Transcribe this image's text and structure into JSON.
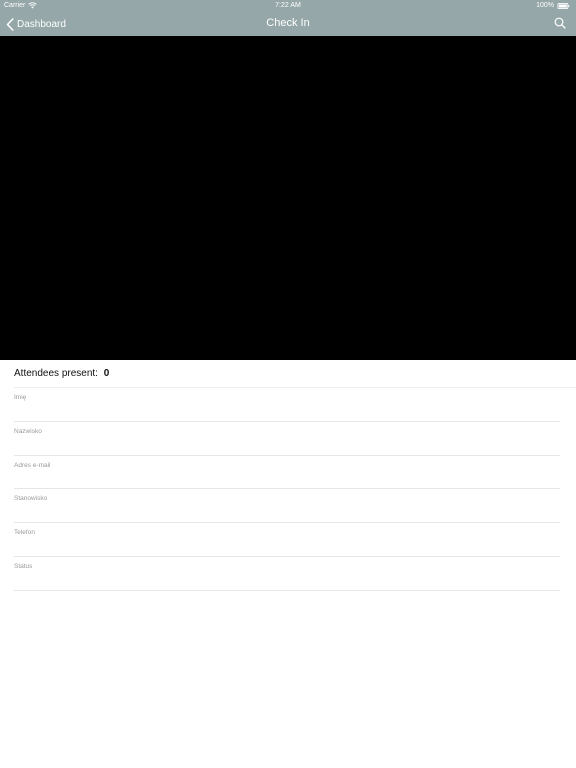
{
  "status_bar": {
    "carrier": "Carrier",
    "time": "7:22 AM",
    "battery": "100%"
  },
  "nav": {
    "back_label": "Dashboard",
    "title": "Check In",
    "search_icon": "search-icon"
  },
  "attendees": {
    "label": "Attendees present:",
    "count": "0"
  },
  "form": {
    "fields": [
      {
        "label": "Imię",
        "value": ""
      },
      {
        "label": "Nazwisko",
        "value": ""
      },
      {
        "label": "Adres e-mail",
        "value": ""
      },
      {
        "label": "Stanowisko",
        "value": ""
      },
      {
        "label": "Telefon",
        "value": ""
      },
      {
        "label": "Status",
        "value": ""
      }
    ]
  },
  "colors": {
    "header": "#95a7a8",
    "camera": "#000000",
    "label": "#9a9a9a"
  }
}
